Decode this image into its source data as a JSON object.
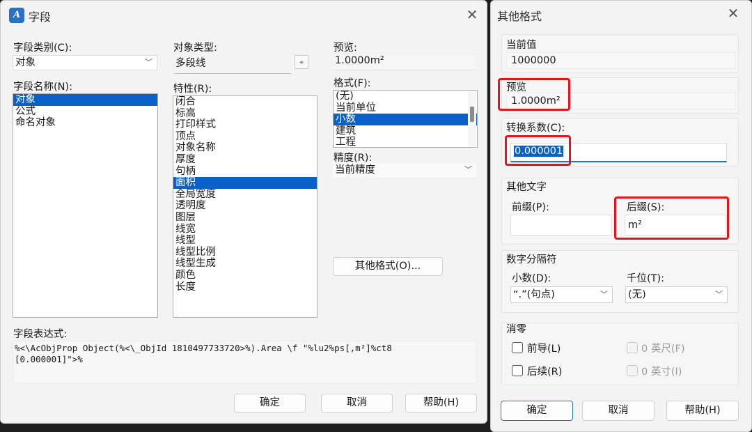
{
  "field_dialog": {
    "title": "字段",
    "close_glyph": "✕",
    "category": {
      "label": "字段类别(C):",
      "value": "对象"
    },
    "name": {
      "label": "字段名称(N):",
      "items": [
        "对象",
        "公式",
        "命名对象"
      ],
      "selected": 0
    },
    "object_type": {
      "label": "对象类型:",
      "value": "多段线"
    },
    "property": {
      "label": "特性(R):",
      "items": [
        "闭合",
        "标高",
        "打印样式",
        "顶点",
        "对象名称",
        "厚度",
        "句柄",
        "面积",
        "全局宽度",
        "透明度",
        "图层",
        "线宽",
        "线型",
        "线型比例",
        "线型生成",
        "颜色",
        "长度"
      ],
      "selected": 7
    },
    "preview": {
      "label": "预览:",
      "value": "1.0000m²"
    },
    "format": {
      "label": "格式(F):",
      "items": [
        "(无)",
        "当前单位",
        "小数",
        "建筑",
        "工程"
      ],
      "selected": 2
    },
    "precision": {
      "label": "精度(R):",
      "value": "当前精度"
    },
    "other_format_button": "其他格式(O)...",
    "expression": {
      "label": "字段表达式:",
      "line1": "%<\\AcObjProp Object(%<\\_ObjId 1810497733720>%).Area \\f \"%lu2%ps[,m²]%ct8",
      "line2": "[0.000001]\">%"
    },
    "buttons": {
      "ok": "确定",
      "cancel": "取消",
      "help": "帮助(H)"
    }
  },
  "other_format_dialog": {
    "title": "其他格式",
    "close_glyph": "✕",
    "current_value": {
      "label": "当前值",
      "value": "1000000"
    },
    "preview": {
      "label": "预览",
      "value": "1.0000m²"
    },
    "conversion": {
      "label": "转换系数(C):",
      "value": "0.000001"
    },
    "other_text": {
      "label": "其他文字",
      "prefix_label": "前缀(P):",
      "prefix_value": "",
      "suffix_label": "后缀(S):",
      "suffix_value": "m²"
    },
    "separator": {
      "label": "数字分隔符",
      "decimal_label": "小数(D):",
      "decimal_value": "“.”(句点)",
      "thousands_label": "千位(T):",
      "thousands_value": "(无)"
    },
    "zero_suppression": {
      "label": "消零",
      "leading": "前导(L)",
      "trailing": "后续(R)",
      "feet": "0 英尺(F)",
      "inches": "0 英寸(I)"
    },
    "buttons": {
      "ok": "确定",
      "cancel": "取消",
      "help": "帮助(H)"
    }
  },
  "colors": {
    "selection": "#0a62c9",
    "highlight_box": "#e8141c",
    "accent": "#2a6fc9"
  }
}
